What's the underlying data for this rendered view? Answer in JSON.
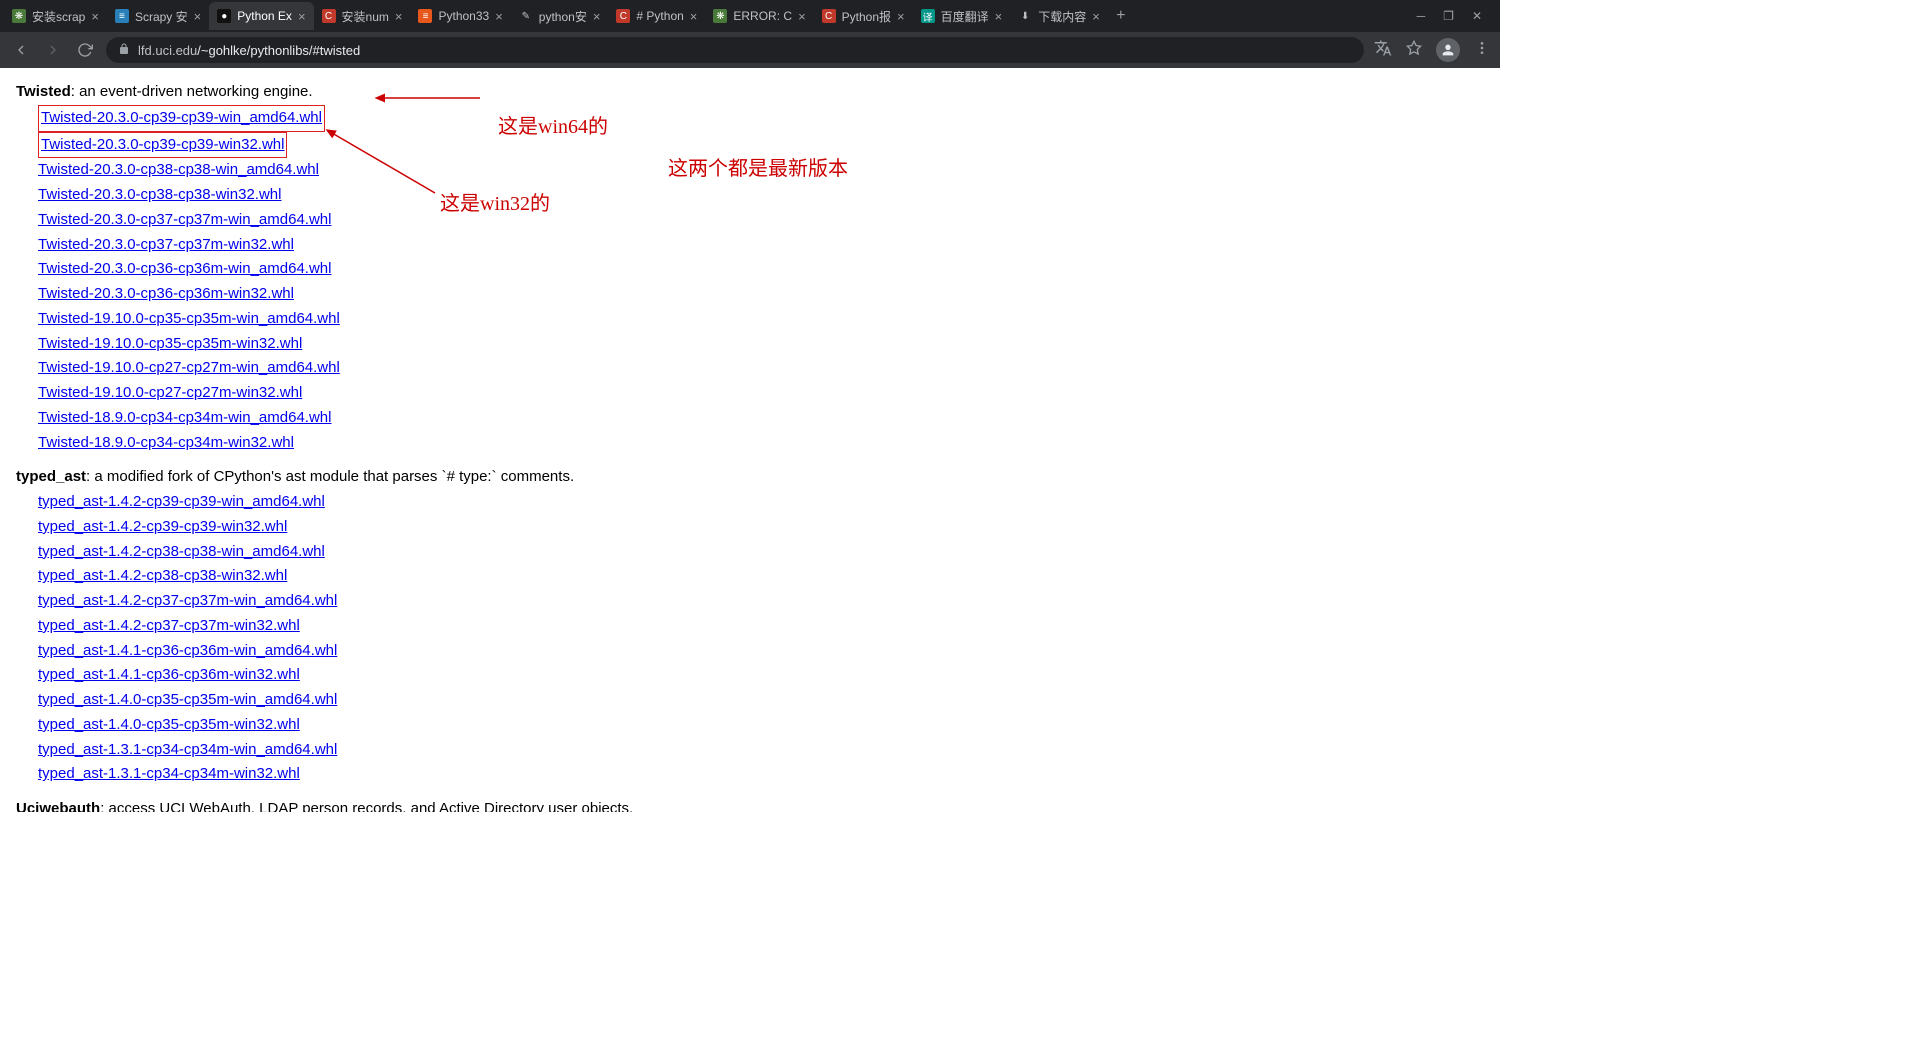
{
  "tabs": [
    {
      "title": "安装scrap",
      "favClass": "fav-spider",
      "favGlyph": "❋",
      "active": false
    },
    {
      "title": "Scrapy 安",
      "favClass": "fav-bluebox",
      "favGlyph": "≡",
      "active": false
    },
    {
      "title": "Python Ex",
      "favClass": "fav-dark",
      "favGlyph": "●",
      "active": true
    },
    {
      "title": "安装num",
      "favClass": "fav-red",
      "favGlyph": "C",
      "active": false
    },
    {
      "title": "Python33",
      "favClass": "fav-orange",
      "favGlyph": "≡",
      "active": false
    },
    {
      "title": "python安",
      "favClass": "",
      "favGlyph": "✎",
      "active": false
    },
    {
      "title": "# Python",
      "favClass": "fav-red",
      "favGlyph": "C",
      "active": false
    },
    {
      "title": "ERROR: C",
      "favClass": "fav-spider",
      "favGlyph": "❋",
      "active": false
    },
    {
      "title": "Python报",
      "favClass": "fav-red",
      "favGlyph": "C",
      "active": false
    },
    {
      "title": "百度翻译",
      "favClass": "fav-teal",
      "favGlyph": "译",
      "active": false
    },
    {
      "title": "下载内容",
      "favClass": "",
      "favGlyph": "⬇",
      "active": false
    }
  ],
  "url": {
    "host": "lfd.uci.edu",
    "path": "/~gohlke/pythonlibs/#twisted"
  },
  "sections": {
    "twisted": {
      "name": "Twisted",
      "desc": ": an event-driven networking engine."
    },
    "typed_ast": {
      "name": "typed_ast",
      "desc": ": a modified fork of CPython's ast module that parses `# type:` comments."
    },
    "uciwebauth": {
      "name": "Uciwebauth",
      "desc": ": access UCI WebAuth, LDAP person records, and Active Directory user objects."
    }
  },
  "twisted_links": [
    "Twisted-20.3.0-cp39-cp39-win_amd64.whl",
    "Twisted-20.3.0-cp39-cp39-win32.whl",
    "Twisted-20.3.0-cp38-cp38-win_amd64.whl",
    "Twisted-20.3.0-cp38-cp38-win32.whl",
    "Twisted-20.3.0-cp37-cp37m-win_amd64.whl",
    "Twisted-20.3.0-cp37-cp37m-win32.whl",
    "Twisted-20.3.0-cp36-cp36m-win_amd64.whl",
    "Twisted-20.3.0-cp36-cp36m-win32.whl",
    "Twisted-19.10.0-cp35-cp35m-win_amd64.whl",
    "Twisted-19.10.0-cp35-cp35m-win32.whl",
    "Twisted-19.10.0-cp27-cp27m-win_amd64.whl",
    "Twisted-19.10.0-cp27-cp27m-win32.whl",
    "Twisted-18.9.0-cp34-cp34m-win_amd64.whl",
    "Twisted-18.9.0-cp34-cp34m-win32.whl"
  ],
  "typed_ast_links": [
    "typed_ast-1.4.2-cp39-cp39-win_amd64.whl",
    "typed_ast-1.4.2-cp39-cp39-win32.whl",
    "typed_ast-1.4.2-cp38-cp38-win_amd64.whl",
    "typed_ast-1.4.2-cp38-cp38-win32.whl",
    "typed_ast-1.4.2-cp37-cp37m-win_amd64.whl",
    "typed_ast-1.4.2-cp37-cp37m-win32.whl",
    "typed_ast-1.4.1-cp36-cp36m-win_amd64.whl",
    "typed_ast-1.4.1-cp36-cp36m-win32.whl",
    "typed_ast-1.4.0-cp35-cp35m-win_amd64.whl",
    "typed_ast-1.4.0-cp35-cp35m-win32.whl",
    "typed_ast-1.3.1-cp34-cp34m-win_amd64.whl",
    "typed_ast-1.3.1-cp34-cp34m-win32.whl"
  ],
  "annotations": {
    "a1": "这是win64的",
    "a2": "这是win32的",
    "a3": "这两个都是最新版本"
  }
}
